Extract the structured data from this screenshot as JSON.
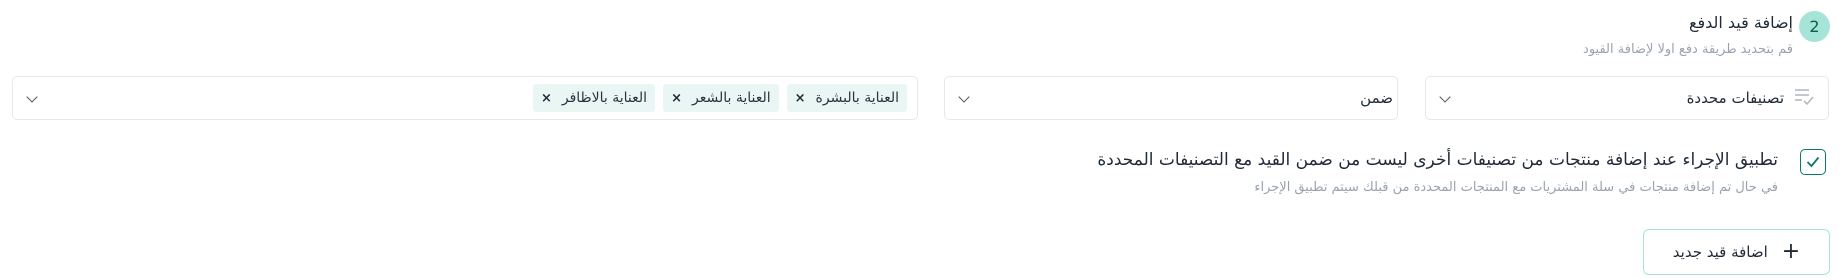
{
  "step": {
    "number": "2",
    "title": "إضافة قيد الدفع",
    "subtitle": "قم بتحديد طريقة دفع اولا لإضافة القيود"
  },
  "fields": {
    "type_select": {
      "value": "تصنيفات محددة",
      "icon": "list-check-icon"
    },
    "condition_select": {
      "value": "ضمن"
    },
    "tags": [
      {
        "label": "العناية بالبشرة"
      },
      {
        "label": "العناية بالشعر"
      },
      {
        "label": "العناية بالاظافر"
      }
    ],
    "remove_symbol": "×"
  },
  "apply_action": {
    "checked": true,
    "label": "تطبيق الإجراء عند إضافة منتجات من تصنيفات أخرى ليست من ضمن القيد مع التصنيفات المحددة",
    "description": "في حال تم إضافة منتجات في سلة المشتريات مع المنتجات المحددة من قبلك سيتم تطبيق الإجراء"
  },
  "add_button": {
    "label": "اضافة قيد جديد",
    "icon": "plus-icon"
  },
  "colors": {
    "accent": "#0e7a66",
    "accent_light": "#a7e4d8",
    "tag_bg": "#eaf6f3",
    "muted": "#9aa3ad"
  }
}
